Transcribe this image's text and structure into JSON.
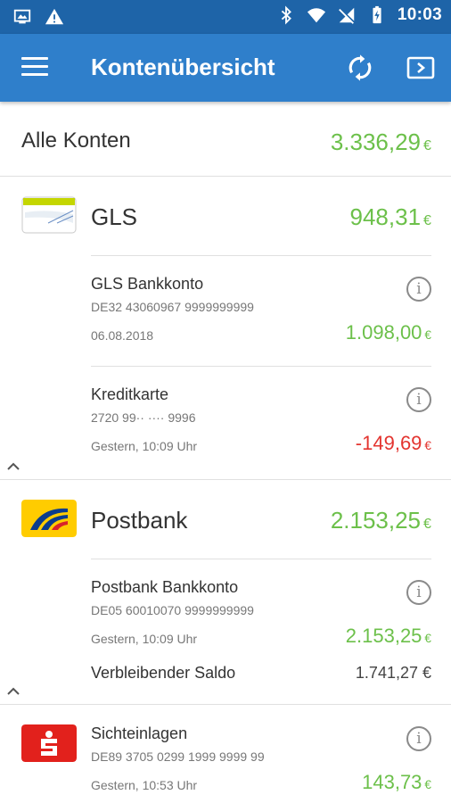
{
  "status_bar": {
    "time": "10:03"
  },
  "app_bar": {
    "title": "Kontenübersicht"
  },
  "total": {
    "label": "Alle Konten",
    "amount": "3.336,29",
    "currency": "€"
  },
  "banks": [
    {
      "name": "GLS",
      "amount": "948,31",
      "currency": "€",
      "accounts": [
        {
          "name": "GLS Bankkonto",
          "iban": "DE32 43060967 9999999999",
          "date": "06.08.2018",
          "amount": "1.098,00",
          "currency": "€"
        },
        {
          "name": "Kreditkarte",
          "iban": "2720 99·· ···· 9996",
          "date": "Gestern, 10:09 Uhr",
          "amount": "-149,69",
          "currency": "€"
        }
      ]
    },
    {
      "name": "Postbank",
      "amount": "2.153,25",
      "currency": "€",
      "accounts": [
        {
          "name": "Postbank Bankkonto",
          "iban": "DE05 60010070 9999999999",
          "date": "Gestern, 10:09 Uhr",
          "amount": "2.153,25",
          "currency": "€",
          "remaining_label": "Verbleibender Saldo",
          "remaining_amount": "1.741,27 €"
        }
      ]
    },
    {
      "accounts": [
        {
          "name": "Sichteinlagen",
          "iban": "DE89 3705 0299 1999 9999 99",
          "date": "Gestern, 10:53 Uhr",
          "amount": "143,73",
          "currency": "€"
        }
      ]
    }
  ],
  "colors": {
    "positive": "#6cc04a",
    "negative": "#e3342f",
    "app_bar": "#2f7fcb",
    "status_bar": "#1e64a8"
  }
}
